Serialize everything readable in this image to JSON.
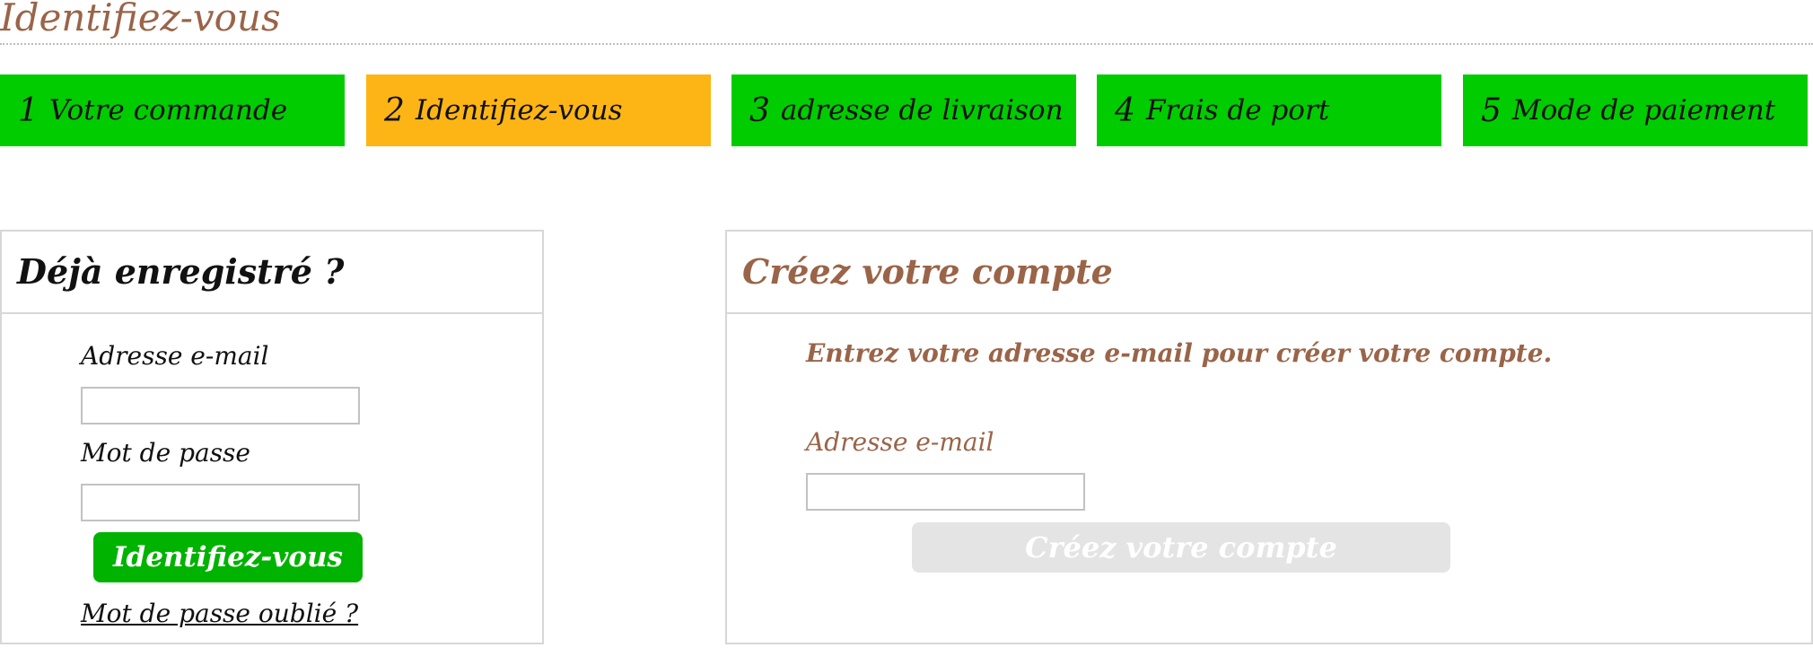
{
  "page": {
    "title": "Identifiez-vous"
  },
  "steps": [
    {
      "num": "1",
      "label": "Votre commande",
      "active": false
    },
    {
      "num": "2",
      "label": "Identifiez-vous",
      "active": true
    },
    {
      "num": "3",
      "label": "adresse de livraison",
      "active": false
    },
    {
      "num": "4",
      "label": "Frais de port",
      "active": false
    },
    {
      "num": "5",
      "label": "Mode de paiement",
      "active": false
    }
  ],
  "login": {
    "title": "Déjà enregistré ?",
    "email_label": "Adresse e-mail",
    "email_value": "",
    "password_label": "Mot de passe",
    "password_value": "",
    "submit_label": "Identifiez-vous",
    "forgot_label": "Mot de passe oublié ?"
  },
  "create": {
    "title": "Créez votre compte",
    "intro": "Entrez votre adresse e-mail pour créer votre compte.",
    "email_label": "Adresse e-mail",
    "email_value": "",
    "submit_label": "Créez votre compte"
  },
  "colors": {
    "step_default": "#00cc00",
    "step_active": "#fdb515",
    "accent_brown": "#9a6448",
    "login_button": "#00b300",
    "create_button_disabled": "#e4e4e4"
  }
}
